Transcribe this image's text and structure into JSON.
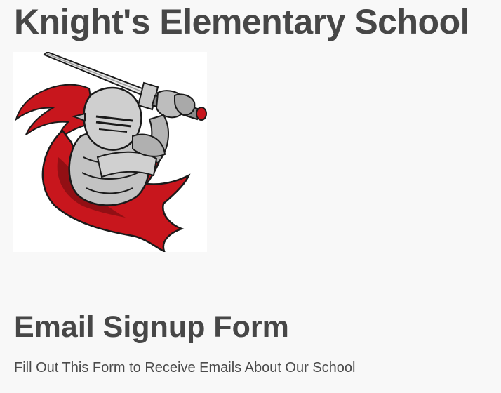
{
  "header": {
    "title": "Knight's Elementary School"
  },
  "logo": {
    "icon": "knight-mascot-icon",
    "colors": {
      "cape": "#c8161d",
      "armor": "#b9b9b9",
      "outline": "#1a1a1a"
    }
  },
  "form": {
    "title": "Email Signup Form",
    "subtitle": "Fill Out This Form to Receive Emails About Our School"
  }
}
